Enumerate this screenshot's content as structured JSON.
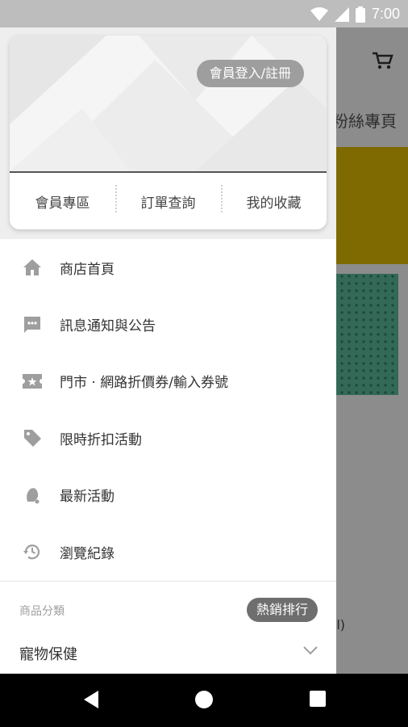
{
  "status_bar": {
    "time": "7:00"
  },
  "background_app": {
    "section_title_fragment": "粉絲專頁",
    "text_fragment": "l)"
  },
  "drawer": {
    "login_button": "會員登入/註冊",
    "card_tabs": [
      "會員專區",
      "訂單查詢",
      "我的收藏"
    ],
    "menu": [
      {
        "label": "商店首頁",
        "icon": "home-icon"
      },
      {
        "label": "訊息通知與公告",
        "icon": "message-icon"
      },
      {
        "label": "門市 · 網路折價券/輸入券號",
        "icon": "coupon-icon"
      },
      {
        "label": "限時折扣活動",
        "icon": "tag-icon"
      },
      {
        "label": "最新活動",
        "icon": "bell-icon"
      },
      {
        "label": "瀏覽紀錄",
        "icon": "history-icon"
      }
    ],
    "category_title": "商品分類",
    "hot_button": "熱銷排行",
    "category_item": "寵物保健"
  },
  "colors": {
    "accent_yellow": "#e6c200",
    "menu_icon": "#9e9e9e",
    "status_bar": "#bdbdbd"
  }
}
